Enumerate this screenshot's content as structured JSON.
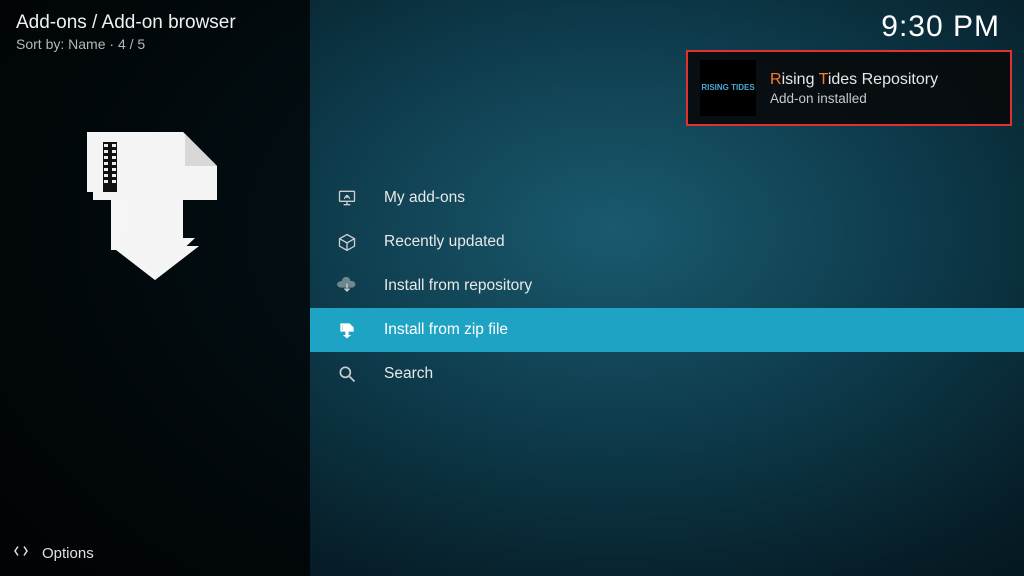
{
  "header": {
    "breadcrumb": "Add-ons / Add-on browser",
    "sort_prefix": "Sort by: ",
    "sort_value": "Name",
    "sort_sep": "  ·  ",
    "position": "4 / 5"
  },
  "clock": "9:30 PM",
  "menu": {
    "items": [
      {
        "icon": "my-addons-icon",
        "label": "My add-ons",
        "selected": false
      },
      {
        "icon": "recently-updated-icon",
        "label": "Recently updated",
        "selected": false
      },
      {
        "icon": "install-repo-icon",
        "label": "Install from repository",
        "selected": false
      },
      {
        "icon": "install-zip-icon",
        "label": "Install from zip file",
        "selected": true
      },
      {
        "icon": "search-icon",
        "label": "Search",
        "selected": false
      }
    ]
  },
  "footer": {
    "options_label": "Options"
  },
  "notification": {
    "thumb_text": "RISING TIDES",
    "title_r": "R",
    "title_ising": "ising ",
    "title_t": "T",
    "title_ides": "ides ",
    "title_rest": "Repository",
    "subtitle": "Add-on installed"
  },
  "colors": {
    "accent": "#1fa3c4",
    "highlight_border": "#e03030",
    "highlight_letter": "#ff7a2a"
  }
}
